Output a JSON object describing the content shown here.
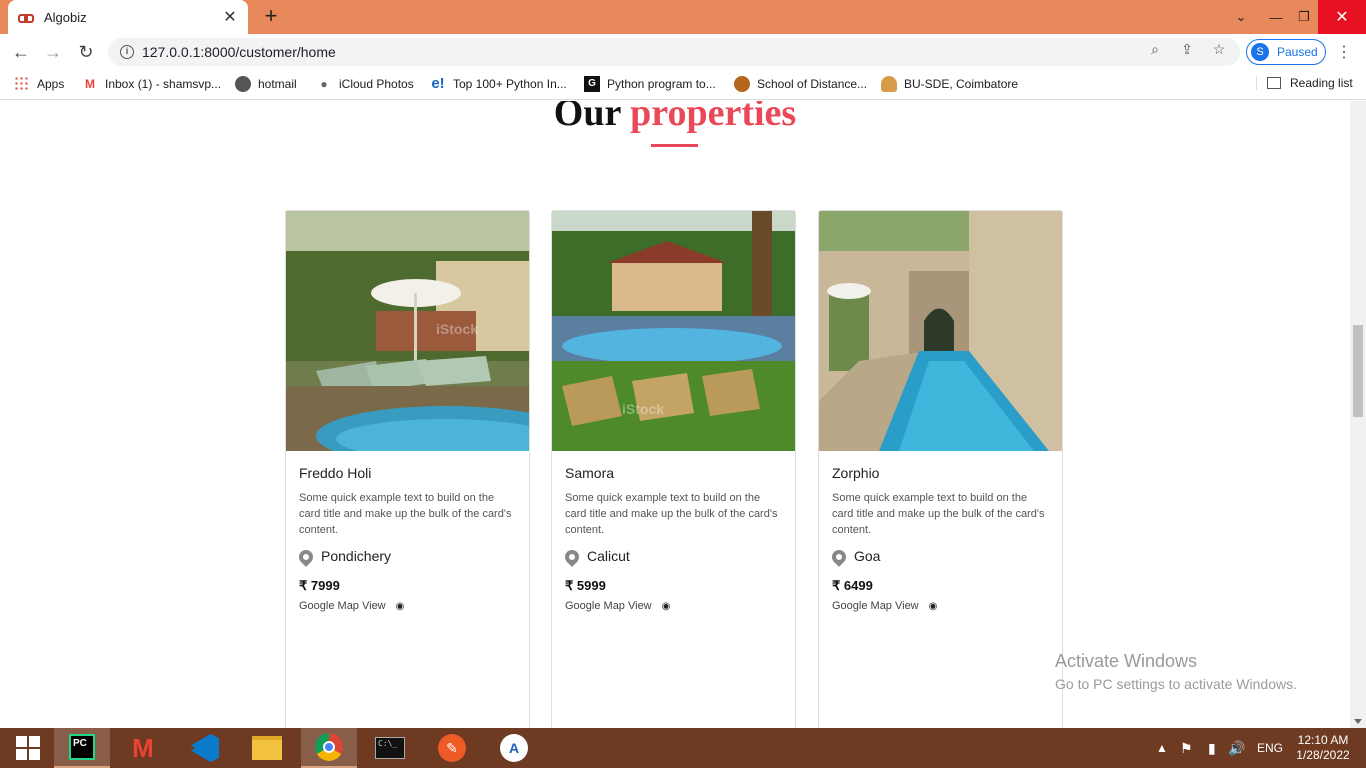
{
  "browser": {
    "tab_title": "Algobiz",
    "url": "127.0.0.1:8000/customer/home",
    "profile_initial": "S",
    "profile_status": "Paused",
    "bookmarks": [
      {
        "label": "Apps",
        "icon": "apps-icon"
      },
      {
        "label": "Inbox (1) - shamsvp...",
        "icon": "gmail-icon"
      },
      {
        "label": "hotmail",
        "icon": "globe-icon"
      },
      {
        "label": "iCloud Photos",
        "icon": "apple-icon"
      },
      {
        "label": "Top 100+ Python In...",
        "icon": "edureka-icon"
      },
      {
        "label": "Python program to...",
        "icon": "gfg-icon"
      },
      {
        "label": "School of Distance...",
        "icon": "crest-icon"
      },
      {
        "label": "BU-SDE, Coimbatore",
        "icon": "person-icon"
      }
    ],
    "reading_list": "Reading list"
  },
  "page": {
    "heading_main": "Our",
    "heading_accent": "properties",
    "accent_color": "#ea4858",
    "cards": [
      {
        "title": "Freddo Holi",
        "text": "Some quick example text to build on the card title and make up the bulk of the card's content.",
        "location": "Pondichery",
        "price": "₹ 7999",
        "map_link": "Google Map View",
        "watermark": "iStock"
      },
      {
        "title": "Samora",
        "text": "Some quick example text to build on the card title and make up the bulk of the card's content.",
        "location": "Calicut",
        "price": "₹ 5999",
        "map_link": "Google Map View",
        "watermark": "iStock"
      },
      {
        "title": "Zorphio",
        "text": "Some quick example text to build on the card title and make up the bulk of the card's content.",
        "location": "Goa",
        "price": "₹ 6499",
        "map_link": "Google Map View",
        "watermark": ""
      }
    ]
  },
  "activation": {
    "title": "Activate Windows",
    "subtitle": "Go to PC settings to activate Windows."
  },
  "taskbar": {
    "apps": [
      "start-icon",
      "pycharm-icon",
      "gmail-icon",
      "vscode-icon",
      "file-explorer-icon",
      "chrome-icon",
      "terminal-icon",
      "postman-icon",
      "app-icon"
    ],
    "language": "ENG",
    "time": "12:10 AM",
    "date": "1/28/2022"
  }
}
